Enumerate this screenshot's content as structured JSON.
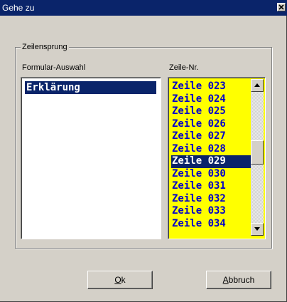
{
  "window": {
    "title": "Gehe zu",
    "close_icon": "close-icon"
  },
  "group": {
    "label": "Zeilensprung"
  },
  "formular": {
    "label": "Formular-Auswahl",
    "items": [
      "Erklärung"
    ],
    "selected": "Erklärung"
  },
  "zeile": {
    "label": "Zeile-Nr.",
    "items": [
      "Zeile 023",
      "Zeile 024",
      "Zeile 025",
      "Zeile 026",
      "Zeile 027",
      "Zeile 028",
      "Zeile 029",
      "Zeile 030",
      "Zeile 031",
      "Zeile 032",
      "Zeile 033",
      "Zeile 034"
    ],
    "selected": "Zeile 029"
  },
  "buttons": {
    "ok_mnemonic": "O",
    "ok_rest": "k",
    "cancel_mnemonic": "A",
    "cancel_rest": "bbruch"
  },
  "colors": {
    "titlebar": "#0a246a",
    "selection": "#0a246a",
    "list_background": "#ffff00",
    "list_text": "#0000cc",
    "dialog": "#d4d0c8"
  }
}
